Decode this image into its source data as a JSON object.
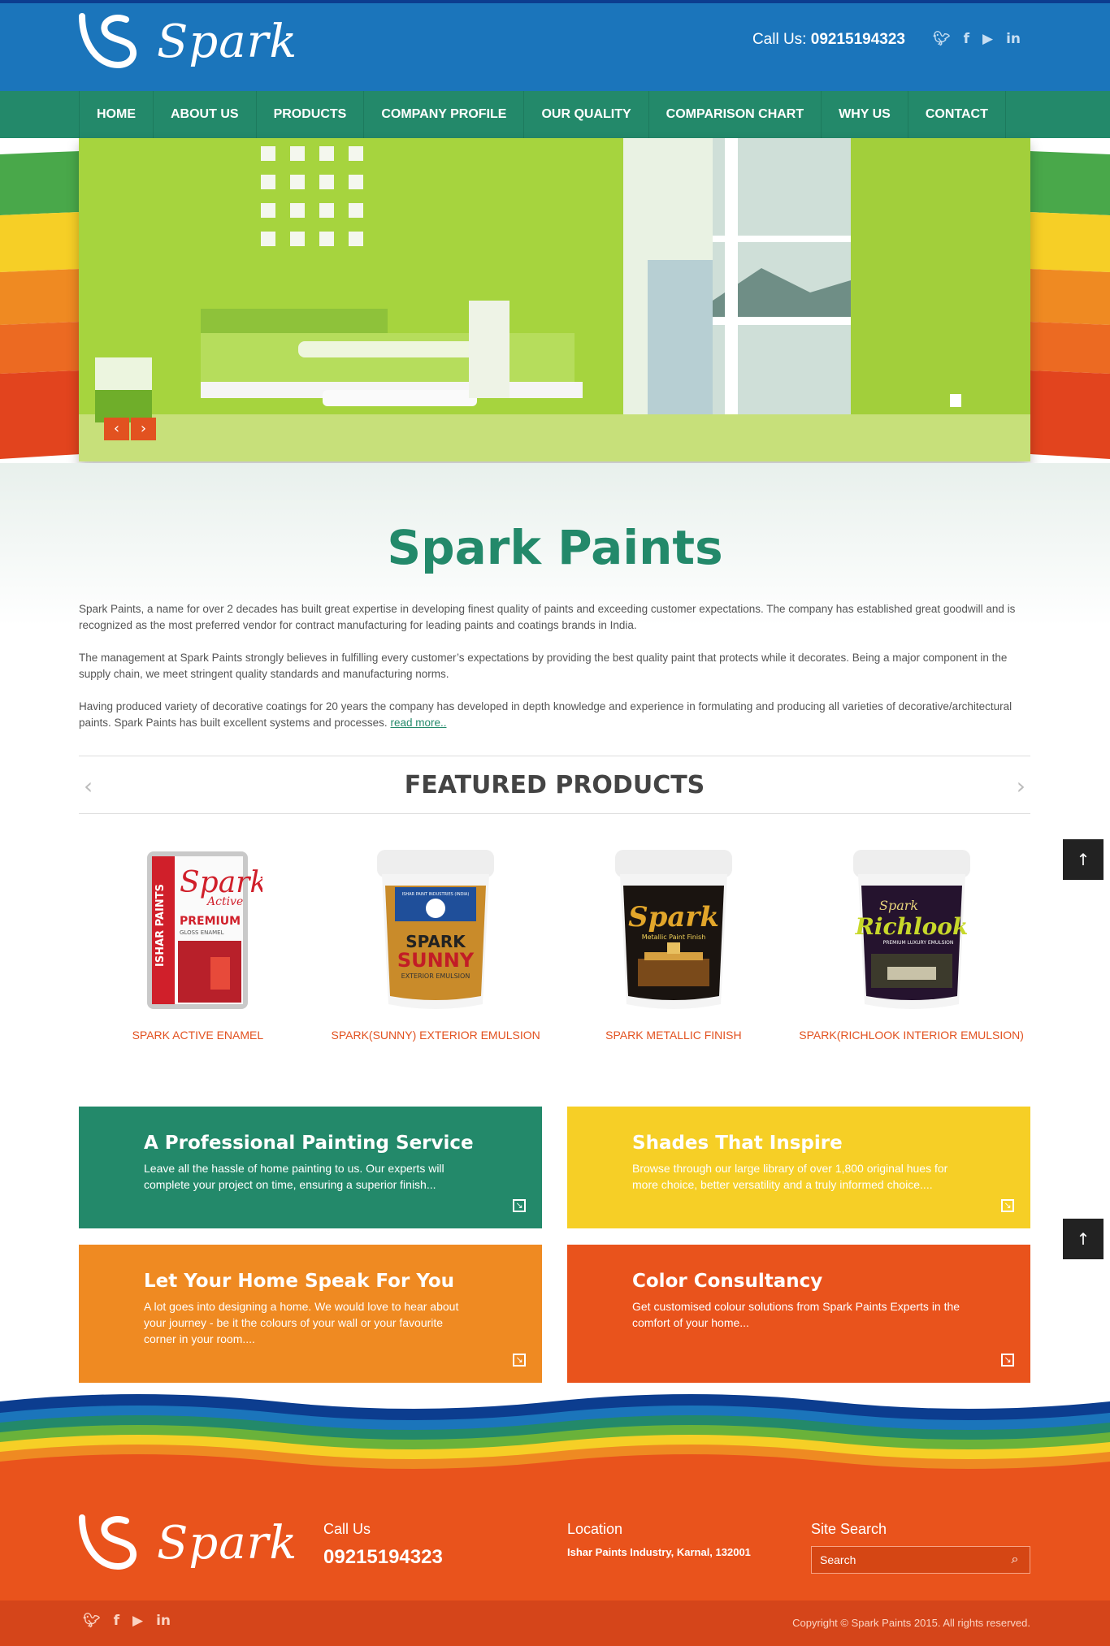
{
  "header": {
    "brand": "Spark",
    "call_label": "Call Us:",
    "phone": "09215194323",
    "social": [
      "twitter-icon",
      "facebook-icon",
      "youtube-icon",
      "linkedin-icon"
    ]
  },
  "nav": [
    "HOME",
    "ABOUT US",
    "PRODUCTS",
    "COMPANY PROFILE",
    "OUR QUALITY",
    "COMPARISON CHART",
    "WHY US",
    "CONTACT"
  ],
  "slider": {
    "prev": "‹",
    "next": "›",
    "dots": 6,
    "active_dot": 2
  },
  "intro": {
    "title": "Spark Paints",
    "paragraphs": [
      "Spark Paints, a name for over 2 decades has built great expertise in developing finest quality of paints and exceeding customer expectations. The company has established great goodwill and is recognized as the most preferred vendor for contract manufacturing for leading paints and coatings brands in India.",
      "The management at Spark Paints strongly believes in fulfilling every customer’s expectations by providing the best quality paint that protects while it decorates. Being a major component in the supply chain, we meet stringent quality standards and manufacturing norms.",
      "Having produced variety of decorative coatings for 20 years the company has developed in depth knowledge and experience in formulating and producing all varieties of decorative/architectural paints. Spark Paints has built excellent systems and processes."
    ],
    "read_more": "read more.."
  },
  "featured": {
    "title": "FEATURED PRODUCTS",
    "prev": "‹",
    "next": "›",
    "products": [
      {
        "name": "SPARK ACTIVE ENAMEL",
        "brand": "Spark",
        "sub": "Active",
        "line1": "PREMIUM",
        "line2": "GLOSS ENAMEL",
        "side": "ISHAR PAINTS"
      },
      {
        "name": "SPARK(SUNNY) EXTERIOR EMULSION",
        "brand": "SPARK",
        "sub": "SUNNY",
        "line1": "EXTERIOR EMULSION",
        "line2": "ISHAR PAINT INDUSTRIES (INDIA)",
        "side": ""
      },
      {
        "name": "SPARK METALLIC FINISH",
        "brand": "Spark",
        "sub": "Metallic Paint Finish",
        "line1": "",
        "line2": "",
        "side": ""
      },
      {
        "name": "SPARK(RICHLOOK INTERIOR EMULSION)",
        "brand": "Spark",
        "sub": "Richlook",
        "line1": "PREMIUM LUXURY EMULSION",
        "line2": "",
        "side": ""
      }
    ]
  },
  "boxes": [
    {
      "title": "A Professional Painting Service",
      "text": "Leave all the hassle of home painting to us. Our experts will complete your project on time, ensuring a superior finish...",
      "color": "#23896a"
    },
    {
      "title": "Shades That Inspire",
      "text": "Browse through our large library of over 1,800 original hues for more choice, better versatility and a truly informed choice....",
      "color": "#f6cf26"
    },
    {
      "title": "Let Your Home Speak For You",
      "text": "A lot goes into designing a home. We would love to hear about your journey - be it the colours of your wall or your favourite corner in your room....",
      "color": "#ef8a22"
    },
    {
      "title": "Color Consultancy",
      "text": "Get customised colour solutions from Spark Paints Experts in the comfort of your home...",
      "color": "#e9531c"
    }
  ],
  "footer": {
    "brand": "Spark",
    "call_heading": "Call Us",
    "phone": "09215194323",
    "location_heading": "Location",
    "location": "Ishar Paints Industry, Karnal, 132001",
    "search_heading": "Site Search",
    "search_placeholder": "Search",
    "copyright": "Copyright © Spark Paints 2015. All rights reserved."
  },
  "colors": {
    "header_blue": "#1b75bb",
    "nav_green": "#23896a",
    "accent_orange": "#e25220",
    "yellow": "#f6cf26",
    "orange": "#ef8a22",
    "red_orange": "#e9531c"
  }
}
